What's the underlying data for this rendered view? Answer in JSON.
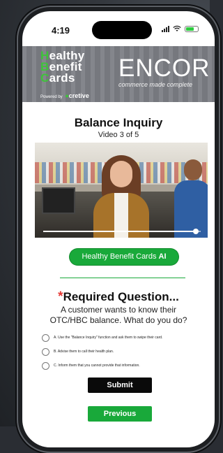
{
  "status_bar": {
    "time": "4:19"
  },
  "banner": {
    "hbc_logo": {
      "lines": [
        {
          "initial": "H",
          "rest": "ealthy"
        },
        {
          "initial": "B",
          "rest": "enefit"
        },
        {
          "initial": "C",
          "rest": "ards"
        }
      ],
      "powered_by": "Powered by",
      "powered_brand_prefix": "",
      "powered_brand": "cretive"
    },
    "encor": {
      "word": "ENCOR",
      "tagline": "commerce made complete"
    }
  },
  "lesson": {
    "title": "Balance Inquiry",
    "subtitle": "Video 3 of 5"
  },
  "video": {
    "progress": 0.97
  },
  "ai_button": {
    "label": "Healthy Benefit Cards ",
    "label_bold": "AI"
  },
  "question": {
    "required_star": "*",
    "required_label": "Required Question...",
    "prompt": "A customer wants to know their OTC/HBC balance. What do you do?",
    "options": [
      "A. Use the \"Balance Inquiry\" function and ask them to swipe their card.",
      "B. Advise them to call their health plan.",
      "C. Inform them that you cannot provide that information."
    ]
  },
  "actions": {
    "submit": "Submit",
    "previous": "Previous"
  },
  "colors": {
    "brand_green": "#19a93a",
    "required_red": "#e53935"
  }
}
